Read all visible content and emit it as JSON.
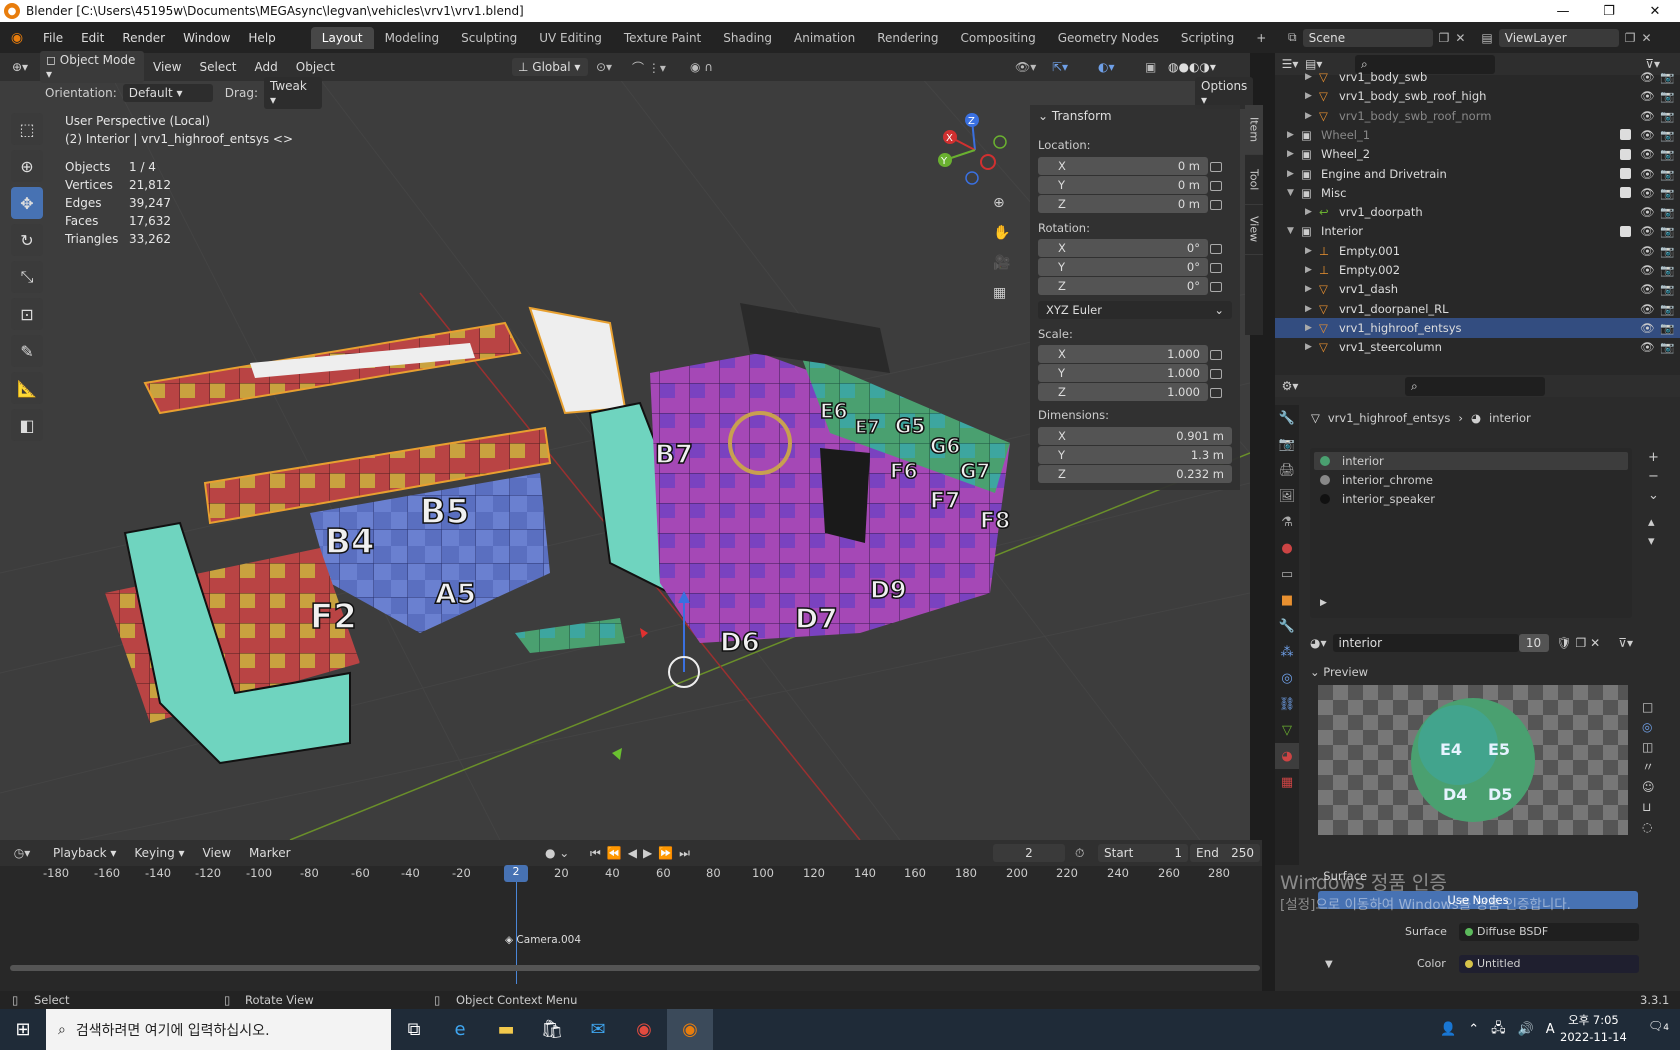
{
  "titlebar": {
    "title": "Blender [C:\\Users\\45195w\\Documents\\MEGAsync\\legvan\\vehicles\\vrv1\\vrv1.blend]",
    "minimize": "—",
    "maximize": "❐",
    "close": "✕"
  },
  "menu": [
    "File",
    "Edit",
    "Render",
    "Window",
    "Help"
  ],
  "workspaces": [
    "Layout",
    "Modeling",
    "Sculpting",
    "UV Editing",
    "Texture Paint",
    "Shading",
    "Animation",
    "Rendering",
    "Compositing",
    "Geometry Nodes",
    "Scripting"
  ],
  "scene": {
    "name": "Scene",
    "view_layer": "ViewLayer"
  },
  "viewport": {
    "mode": "Object Mode",
    "menus": [
      "View",
      "Select",
      "Add",
      "Object"
    ],
    "transform_orientation": "Global",
    "orientation_label": "Orientation:",
    "orientation_value": "Default",
    "drag_label": "Drag:",
    "drag_value": "Tweak",
    "options": "Options",
    "view_name": "User Perspective (Local)",
    "context": "(2) Interior | vrv1_highroof_entsys <>",
    "stats": [
      {
        "label": "Objects",
        "value": "1 / 4"
      },
      {
        "label": "Vertices",
        "value": "21,812"
      },
      {
        "label": "Edges",
        "value": "39,247"
      },
      {
        "label": "Faces",
        "value": "17,632"
      },
      {
        "label": "Triangles",
        "value": "33,262"
      }
    ],
    "uv_labels": [
      "B5",
      "B4",
      "A5",
      "F2",
      "D7",
      "D6",
      "D9",
      "F7",
      "F8",
      "G7",
      "G6",
      "G5",
      "E6",
      "E7",
      "F6",
      "B7"
    ]
  },
  "npanel": {
    "tabs": [
      "Item",
      "Tool",
      "View"
    ],
    "header": "Transform",
    "location_label": "Location:",
    "location": {
      "x": "0 m",
      "y": "0 m",
      "z": "0 m"
    },
    "rotation_label": "Rotation:",
    "rotation": {
      "x": "0°",
      "y": "0°",
      "z": "0°"
    },
    "rotation_mode": "XYZ Euler",
    "scale_label": "Scale:",
    "scale": {
      "x": "1.000",
      "y": "1.000",
      "z": "1.000"
    },
    "dimensions_label": "Dimensions:",
    "dimensions": {
      "x": "0.901 m",
      "y": "1.3 m",
      "z": "0.232 m"
    },
    "axis": {
      "x": "X",
      "y": "Y",
      "z": "Z"
    }
  },
  "outliner": {
    "rows": [
      {
        "name": "vrv1_body_swb",
        "indent": 3,
        "type": "mesh",
        "selected": false
      },
      {
        "name": "vrv1_body_swb_roof_high",
        "indent": 3,
        "type": "mesh",
        "selected": false
      },
      {
        "name": "vrv1_body_swb_roof_norm",
        "indent": 3,
        "type": "mesh",
        "selected": false,
        "dim": true
      },
      {
        "name": "Wheel_1",
        "indent": 2,
        "type": "collection",
        "selected": false,
        "dim": true
      },
      {
        "name": "Wheel_2",
        "indent": 2,
        "type": "collection",
        "selected": false
      },
      {
        "name": "Engine and Drivetrain",
        "indent": 2,
        "type": "collection",
        "selected": false
      },
      {
        "name": "Misc",
        "indent": 2,
        "type": "collection",
        "selected": false,
        "open": true
      },
      {
        "name": "vrv1_doorpath",
        "indent": 3,
        "type": "curve",
        "selected": false
      },
      {
        "name": "Interior",
        "indent": 2,
        "type": "collection",
        "selected": false,
        "open": true
      },
      {
        "name": "Empty.001",
        "indent": 3,
        "type": "empty",
        "selected": false
      },
      {
        "name": "Empty.002",
        "indent": 3,
        "type": "empty",
        "selected": false
      },
      {
        "name": "vrv1_dash",
        "indent": 3,
        "type": "mesh",
        "selected": false
      },
      {
        "name": "vrv1_doorpanel_RL",
        "indent": 3,
        "type": "mesh",
        "selected": false
      },
      {
        "name": "vrv1_highroof_entsys",
        "indent": 3,
        "type": "mesh",
        "selected": true
      },
      {
        "name": "vrv1_steercolumn",
        "indent": 3,
        "type": "mesh",
        "selected": false
      }
    ]
  },
  "properties": {
    "breadcrumb_object": "vrv1_highroof_entsys",
    "breadcrumb_material": "interior",
    "material_slots": [
      "interior",
      "interior_chrome",
      "interior_speaker"
    ],
    "material_name": "interior",
    "users": "10",
    "preview_label": "Preview",
    "preview_labels": [
      "E4",
      "E5",
      "D4",
      "D5"
    ],
    "surface_label": "Surface",
    "use_nodes": "Use Nodes",
    "surface_field_label": "Surface",
    "surface_value": "Diffuse BSDF",
    "color_label": "Color",
    "color_value": "Untitled"
  },
  "watermark": {
    "line1": "Windows 정품 인증",
    "line2": "[설정]으로 이동하여 Windows를 정품 인증합니다."
  },
  "timeline": {
    "menus": [
      "Playback",
      "Keying",
      "View",
      "Marker"
    ],
    "current_frame": "2",
    "start_label": "Start",
    "start": "1",
    "end_label": "End",
    "end": "250",
    "ticks": [
      "-180",
      "-160",
      "-140",
      "-120",
      "-100",
      "-80",
      "-60",
      "-40",
      "-20",
      "20",
      "40",
      "60",
      "80",
      "100",
      "120",
      "140",
      "160",
      "180",
      "200",
      "220",
      "240",
      "260",
      "280"
    ],
    "playhead": "2",
    "marker": "Camera.004"
  },
  "statusbar": {
    "select": "Select",
    "rotate": "Rotate View",
    "context_menu": "Object Context Menu",
    "version": "3.3.1"
  },
  "taskbar": {
    "search": "검색하려면 여기에 입력하십시오.",
    "time": "오후 7:05",
    "date": "2022-11-14",
    "notif": "4",
    "ime": "A"
  }
}
